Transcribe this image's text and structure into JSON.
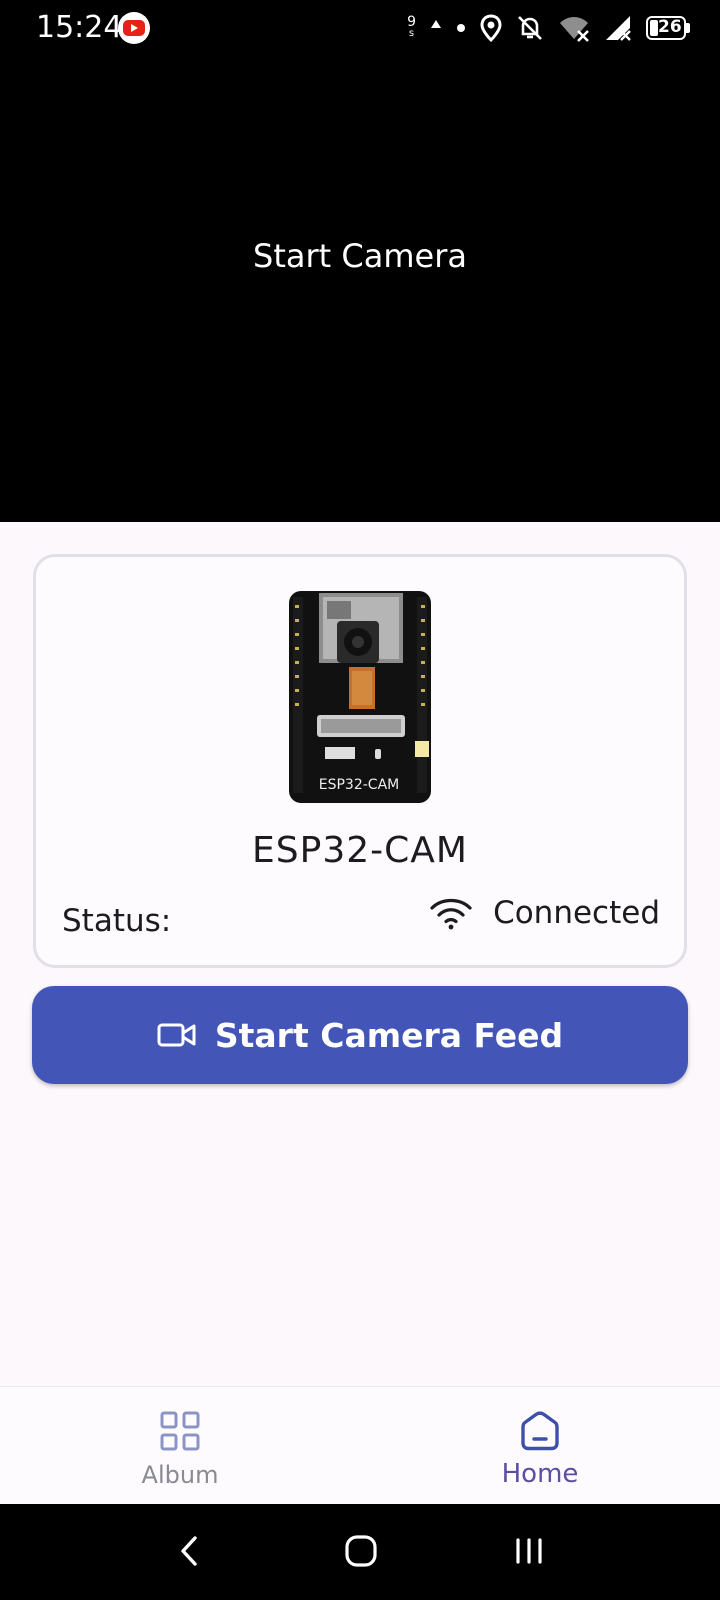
{
  "status_bar": {
    "time": "15:24",
    "speed_top": "9",
    "speed_unit": "s",
    "battery": "26",
    "icons": [
      "youtube-notification-icon",
      "data-activity-icon",
      "dot-icon",
      "location-icon",
      "bell-off-icon",
      "wifi-x-icon",
      "cell-signal-x-icon",
      "battery-icon"
    ]
  },
  "camera": {
    "placeholder": "Start Camera"
  },
  "device": {
    "name": "ESP32-CAM",
    "board_silkscreen": "ESP32-CAM",
    "status_label": "Status:",
    "status_value": "Connected",
    "status_icon": "wifi-icon"
  },
  "actions": {
    "start_feed_label": "Start Camera Feed",
    "start_feed_icon": "video-camera-icon",
    "accent": "#4355b7"
  },
  "bottom_nav": {
    "items": [
      {
        "label": "Album",
        "icon": "grid-icon",
        "selected": false
      },
      {
        "label": "Home",
        "icon": "home-icon",
        "selected": true
      }
    ]
  },
  "system_nav": {
    "buttons": [
      "back-icon",
      "home-circle-icon",
      "recents-icon"
    ]
  }
}
